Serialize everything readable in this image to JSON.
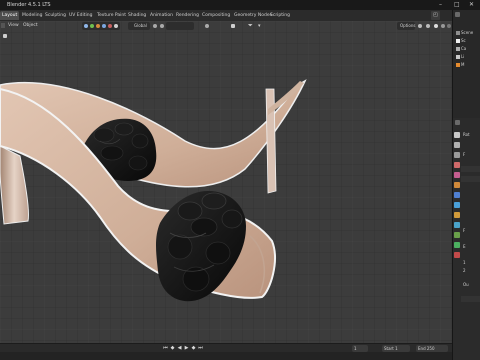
{
  "app": {
    "title": "Blender 4.5.1 LTS"
  },
  "workspaces": [
    {
      "label": "Layout",
      "active": true
    },
    {
      "label": "Modeling"
    },
    {
      "label": "Sculpting"
    },
    {
      "label": "UV Editing"
    },
    {
      "label": "Texture Paint"
    },
    {
      "label": "Shading"
    },
    {
      "label": "Animation"
    },
    {
      "label": "Rendering"
    },
    {
      "label": "Compositing"
    },
    {
      "label": "Geometry Nodes"
    },
    {
      "label": "Scripting"
    }
  ],
  "viewport": {
    "view_menu": "View",
    "object_menu": "Object",
    "transform_orientation": "Global",
    "options_label": "Options"
  },
  "outliner": {
    "items": [
      {
        "label": "Scene"
      },
      {
        "label": "Sc"
      },
      {
        "label": "Ca"
      },
      {
        "label": "Li"
      },
      {
        "label": "M"
      }
    ]
  },
  "properties": {
    "labels": [
      "Rot",
      "F",
      "F",
      "E",
      "1",
      "2",
      "Ou"
    ]
  },
  "timeline": {
    "current_frame": "1",
    "start_label": "Start",
    "start_value": "1",
    "end_label": "End",
    "end_value": "250"
  },
  "colors": {
    "accent": "#4772b3",
    "sole_skin": "#d8b9a5",
    "strap_black": "#111111"
  }
}
